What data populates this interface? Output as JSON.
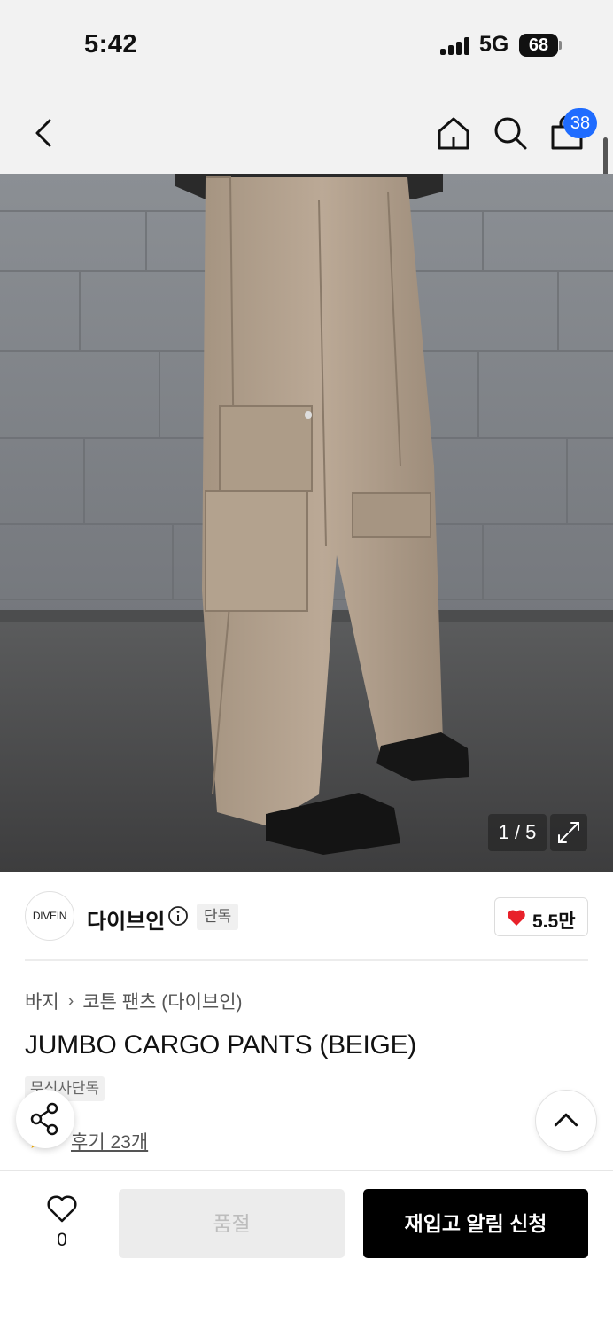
{
  "status_bar": {
    "time": "5:42",
    "network": "5G",
    "battery": "68",
    "icons": [
      "signal-icon",
      "battery-icon"
    ]
  },
  "nav": {
    "icons": [
      "back-arrow-icon",
      "home-icon",
      "search-icon",
      "shopping-bag-icon"
    ],
    "cart_badge": "38"
  },
  "gallery": {
    "counter": "1 / 5",
    "icons": [
      "expand-icon"
    ]
  },
  "brand": {
    "logo_text": "DIVEIN",
    "name": "다이브인",
    "tag": "단독",
    "like_count": "5.5만",
    "icons": [
      "info-icon",
      "heart-filled-icon"
    ],
    "accent_color": "#e8212a"
  },
  "product": {
    "breadcrumb": [
      "바지",
      "코튼 팬츠 (다이브인)"
    ],
    "title": "JUMBO CARGO PANTS (BEIGE)",
    "exclusive_tag": "무신사단독",
    "review_link": "후기 23개",
    "icons": [
      "star-icon",
      "share-icon",
      "chevron-up-icon"
    ]
  },
  "bottom_bar": {
    "wish_count": "0",
    "soldout_label": "품절",
    "restock_label": "재입고 알림 신청",
    "icons": [
      "heart-outline-icon"
    ]
  }
}
